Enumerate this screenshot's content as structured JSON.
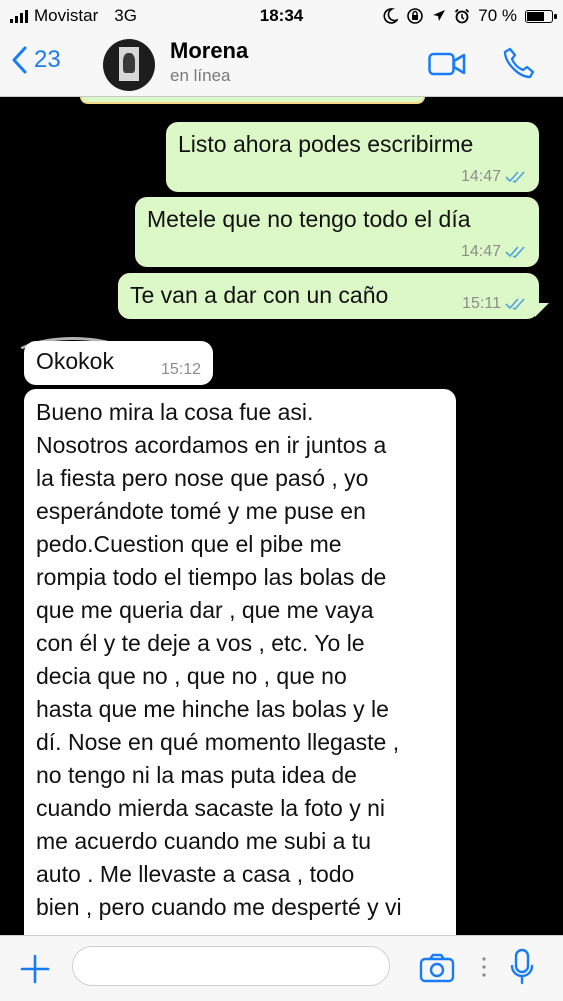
{
  "status_bar": {
    "carrier": "Movistar",
    "network": "3G",
    "time": "18:34",
    "battery": "70 %",
    "battery_level": 0.7,
    "icons": [
      "signal-icon",
      "moon-icon",
      "lock-rotation-icon",
      "location-icon",
      "alarm-icon",
      "battery-icon"
    ]
  },
  "header": {
    "back_count": "23",
    "contact_name": "Morena",
    "contact_status": "en línea",
    "icons": [
      "chevron-left-icon",
      "video-call-icon",
      "phone-icon"
    ]
  },
  "messages": [
    {
      "direction": "outgoing",
      "text": "Listo ahora podes escribirme",
      "time": "14:47",
      "read": true
    },
    {
      "direction": "outgoing",
      "text": "Metele que no tengo todo el día",
      "time": "14:47",
      "read": true
    },
    {
      "direction": "outgoing",
      "text": "Te van a dar con un caño",
      "time": "15:11",
      "read": true
    },
    {
      "direction": "incoming",
      "text": "Okokok",
      "time": "15:12"
    },
    {
      "direction": "incoming",
      "lines": [
        "Bueno mira la cosa fue asi.",
        "Nosotros acordamos en ir juntos a",
        "la fiesta pero nose que pasó , yo",
        "esperándote tomé y me puse en",
        "pedo.Cuestion que el pibe me",
        "rompia todo el tiempo las bolas de",
        "que me queria dar , que me vaya",
        "con él y te deje a vos , etc. Yo le",
        "decia que no , que no , que no",
        "hasta que me hinche las bolas y le",
        "dí. Nose en qué momento llegaste ,",
        "no tengo ni la mas puta idea de",
        "cuando mierda sacaste la foto y ni",
        "me acuerdo cuando me subi a tu",
        "auto . Me llevaste a casa , todo",
        "bien , pero cuando me desperté y vi"
      ]
    }
  ],
  "input_bar": {
    "placeholder": "",
    "icons": [
      "plus-icon",
      "camera-icon",
      "more-dots-icon",
      "microphone-icon"
    ]
  },
  "colors": {
    "accent": "#1a7cf4",
    "outgoing_bubble": "#dcf8c6",
    "incoming_bubble": "#ffffff",
    "chat_background": "#000000",
    "read_ticks": "#4fa3e0"
  }
}
